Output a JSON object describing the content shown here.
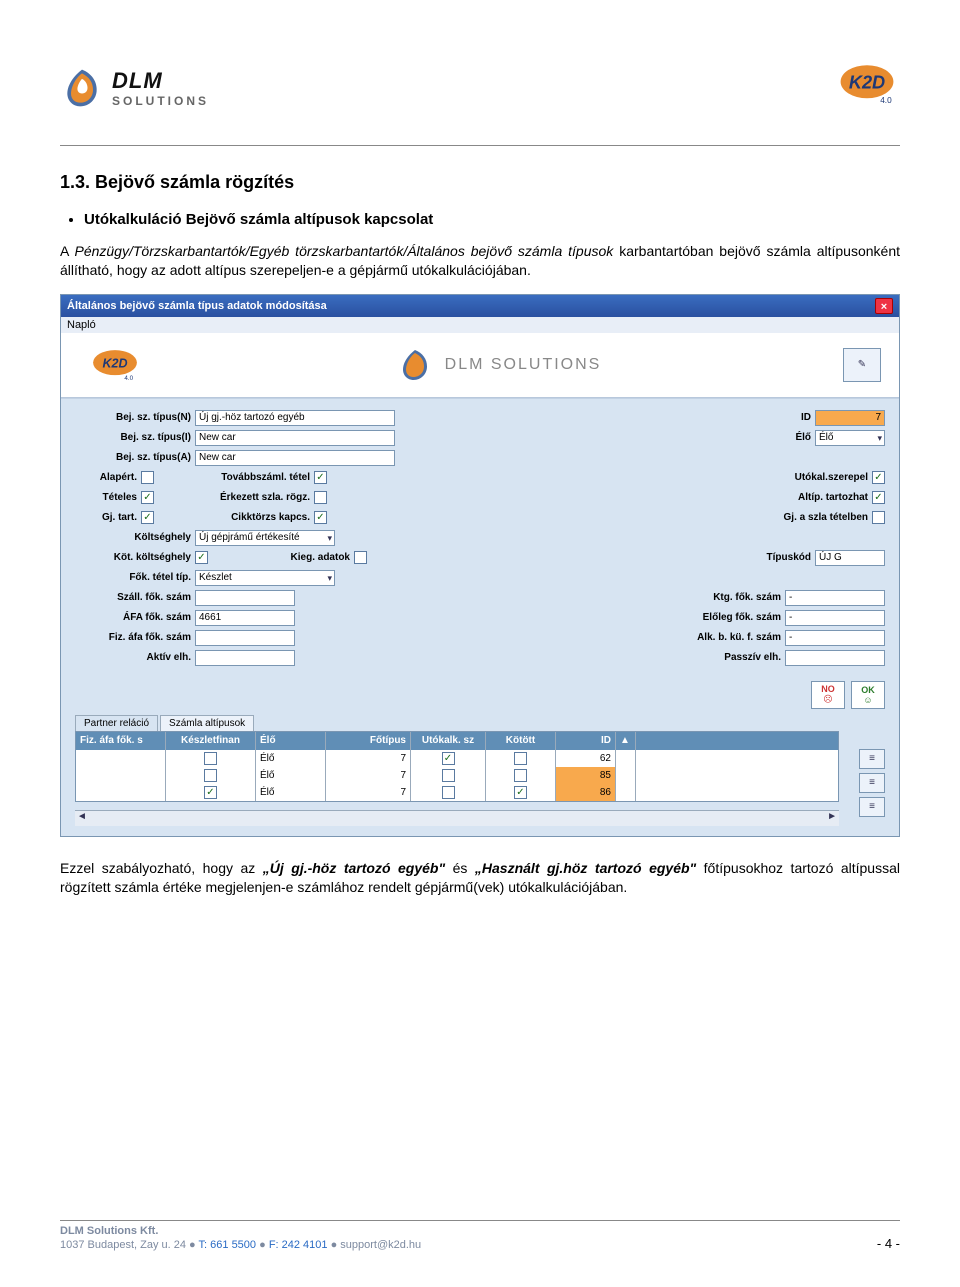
{
  "header": {
    "dlm_name": "DLM",
    "dlm_sub": "SOLUTIONS",
    "k2d_ver": "4.0"
  },
  "section": {
    "heading": "1.3.   Bejövő számla rögzítés",
    "bullet": "Utókalkuláció Bejövő számla altípusok kapcsolat",
    "para1_a": "A ",
    "para1_b": "Pénzügy/Törzskarbantartók/Egyéb törzskarbantartók/Általános bejövő számla típusok",
    "para1_c": " karbantartóban bejövő számla altípusonként állítható, hogy az adott altípus szerepeljen-e a gépjármű utókalkulációjában.",
    "para2_a": "Ezzel szabályozható, hogy az ",
    "para2_b": "„Új gj.-höz tartozó egyéb\"",
    "para2_c": " és ",
    "para2_d": "„Használt gj.höz tartozó egyéb\"",
    "para2_e": " főtípusokhoz tartozó altípussal rögzített számla értéke megjelenjen-e számlához rendelt gépjármű(vek) utókalkulációjában."
  },
  "win": {
    "title": "Általános bejövő számla típus adatok módosítása",
    "menu": "Napló",
    "banner_dlm": "DLM SOLUTIONS",
    "labels": {
      "bej_n": "Bej. sz. típus(N)",
      "bej_i": "Bej. sz. típus(I)",
      "bej_a": "Bej. sz. típus(A)",
      "id": "ID",
      "elo": "Élő",
      "alapert": "Alapért.",
      "tovabb": "Továbbszáml. tétel",
      "utokal": "Utókal.szerepel",
      "teteles": "Tételes",
      "erkezett": "Érkezett szla. rögz.",
      "altip": "Altíp. tartozhat",
      "gjtart": "Gj. tart.",
      "cikk": "Cikktörzs kapcs.",
      "gjszla": "Gj. a szla tételben",
      "koltseghely": "Költséghely",
      "kot_koltseghely": "Köt. költséghely",
      "kieg": "Kieg. adatok",
      "tipuskod": "Típuskód",
      "fok_tetel": "Fők. tétel típ.",
      "szall_fok": "Száll. fők. szám",
      "ktg_fok": "Ktg. fők. szám",
      "afa_fok": "ÁFA fők. szám",
      "eloleg_fok": "Előleg fők. szám",
      "fiz_afa": "Fiz. áfa fők. szám",
      "alk": "Alk. b. kü. f. szám",
      "aktiv": "Aktív elh.",
      "passziv": "Passzív elh."
    },
    "values": {
      "bej_n": "Új gj.-höz tartozó egyéb",
      "bej_i": "New car",
      "bej_a": "New car",
      "id": "7",
      "elo": "Élő",
      "koltseghely": "Új gépjrámű értékesíté",
      "tipuskod": "ÚJ G",
      "fok_tetel": "Készlet",
      "afa_fok": "4661",
      "ktg_fok": "-",
      "eloleg_fok": "-",
      "alk": "-"
    },
    "btn_no": "NO",
    "btn_ok": "OK",
    "tabs": {
      "partner": "Partner reláció",
      "altip": "Számla altípusok"
    },
    "grid": {
      "headers": {
        "fiz": "Fiz. áfa fők. s",
        "kesz": "Készletfinan",
        "elo": "Élő",
        "fot": "Főtípus",
        "uto": "Utókalk. sz",
        "kot": "Kötött",
        "id": "ID"
      },
      "rows": [
        {
          "kesz": false,
          "elo": "Élő",
          "fot": "7",
          "uto": true,
          "kot": false,
          "id": "62",
          "orange": false
        },
        {
          "kesz": false,
          "elo": "Élő",
          "fot": "7",
          "uto": false,
          "kot": false,
          "id": "85",
          "orange": true
        },
        {
          "kesz": true,
          "elo": "Élő",
          "fot": "7",
          "uto": false,
          "kot": true,
          "id": "86",
          "orange": true
        }
      ]
    }
  },
  "footer": {
    "l1": "DLM Solutions Kft.",
    "l2_a": "1037 Budapest, Zay u. 24  ●  ",
    "l2_b": "T: 661 5500",
    "l2_c": "  ●  ",
    "l2_d": "F: 242 4101",
    "l2_e": "  ●  support@k2d.hu",
    "page": "- 4 -"
  }
}
